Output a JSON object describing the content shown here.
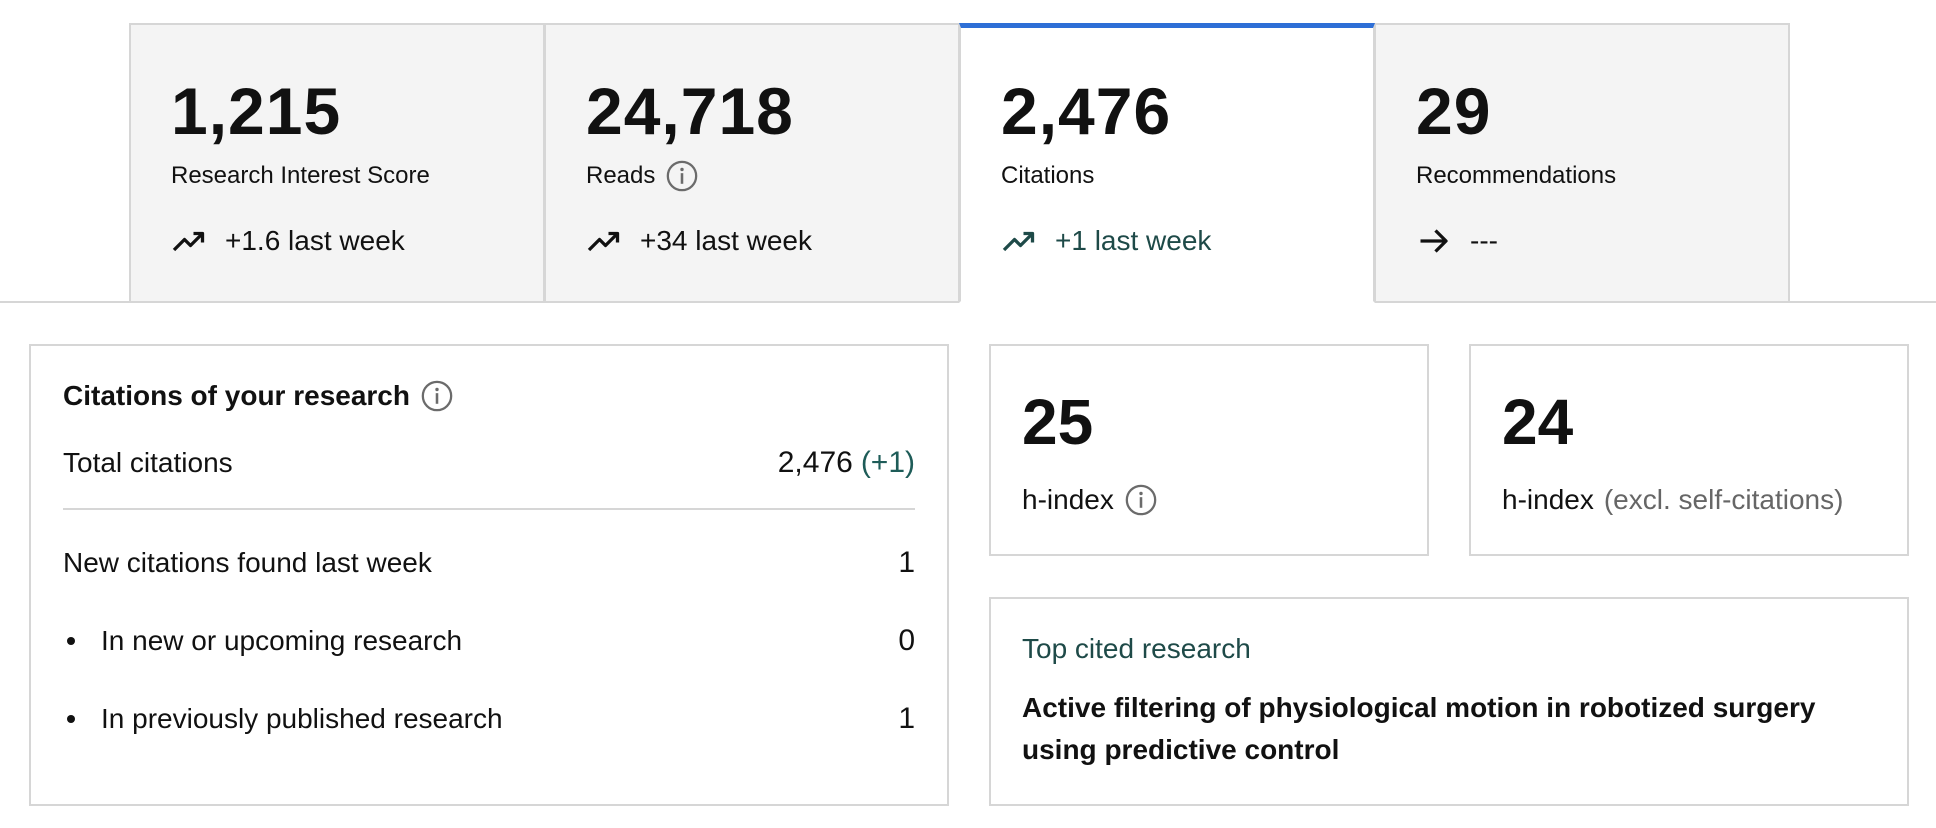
{
  "stats": [
    {
      "value": "1,215",
      "label": "Research Interest Score",
      "trend": "+1.6 last week",
      "trend_icon": "trending-up-icon",
      "active": false,
      "info": false
    },
    {
      "value": "24,718",
      "label": "Reads",
      "trend": "+34 last week",
      "trend_icon": "trending-up-icon",
      "active": false,
      "info": true
    },
    {
      "value": "2,476",
      "label": "Citations",
      "trend": "+1 last week",
      "trend_icon": "trending-up-icon",
      "active": true,
      "info": false
    },
    {
      "value": "29",
      "label": "Recommendations",
      "trend": "---",
      "trend_icon": "arrow-right-icon",
      "active": false,
      "info": false
    }
  ],
  "citations": {
    "title": "Citations of your research",
    "total_label": "Total citations",
    "total_value": "2,476",
    "total_delta": "(+1)",
    "new_label": "New citations found last week",
    "new_value": "1",
    "items": [
      {
        "label": "In new or upcoming research",
        "value": "0"
      },
      {
        "label": "In previously published research",
        "value": "1"
      }
    ]
  },
  "h_index": {
    "value": "25",
    "label": "h-index"
  },
  "h_index_excl": {
    "value": "24",
    "label": "h-index",
    "sub": "(excl. self-citations)"
  },
  "top_cited": {
    "header": "Top cited research",
    "title": "Active filtering of physiological motion in robotized surgery using predictive control"
  },
  "colors": {
    "active_tab_accent": "#2e6fd6",
    "trend_green": "#1e4a48",
    "border": "#d6d6d6",
    "tab_bg": "#f4f4f4"
  }
}
